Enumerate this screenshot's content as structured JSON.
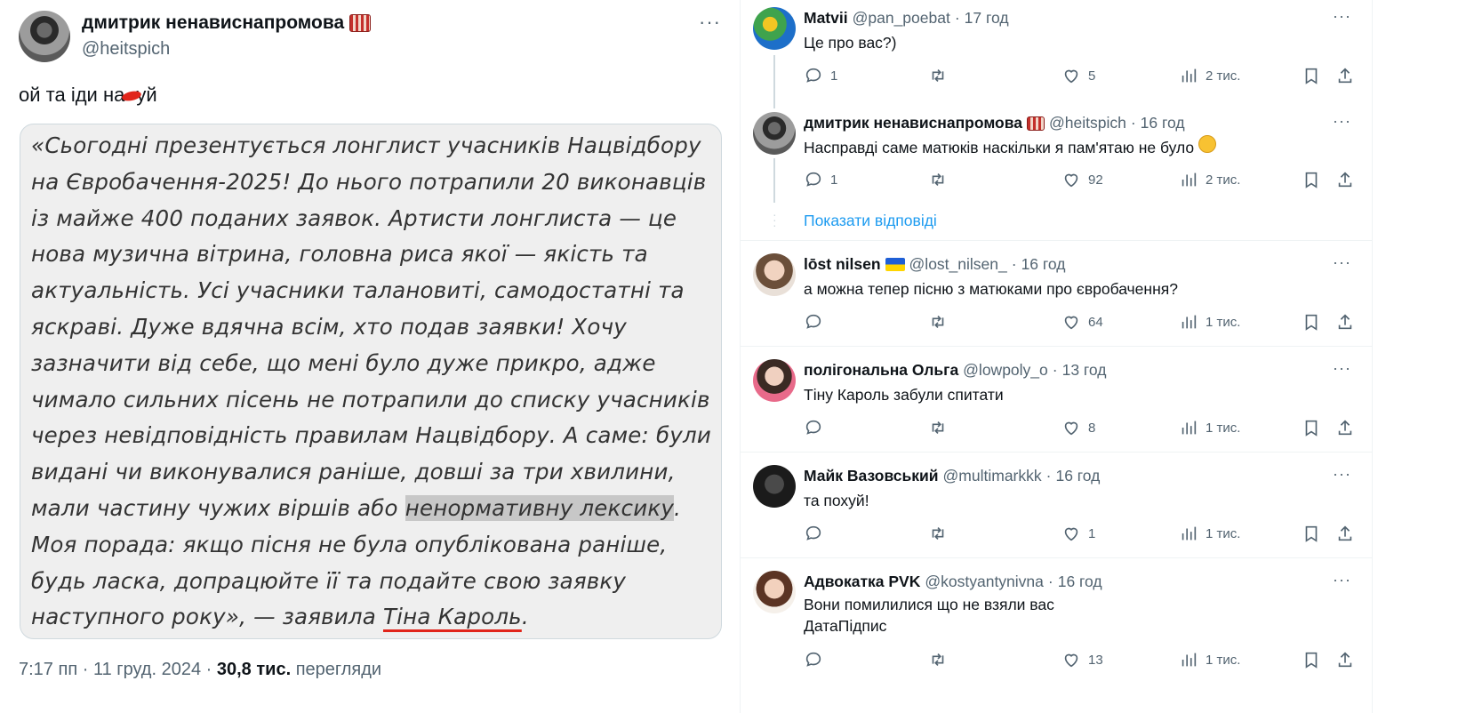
{
  "main_tweet": {
    "author_name": "дмитрик ненависнапромова",
    "author_emoji": "accordion-emoji",
    "handle": "@heitspich",
    "more": "···",
    "text_before": "ой та іди на",
    "text_after": "уй",
    "quote": {
      "part1": "«Сьогодні презентується лонглист учасників Нацвідбору на Євробачення-2025! До нього потрапили 20 виконавців із майже 400 поданих заявок. Артисти лонглиста — це нова музична вітрина, головна риса якої — якість та актуальність. Усі учасники талановиті, самодостатні та яскраві. Дуже вдячна всім, хто подав заявки! Хочу зазначити від себе, що мені було дуже прикро, адже чимало сильних пісень не потрапили до списку учасників через невідповідність правилам Нацвідбору. А саме: були видані чи виконувалися раніше, довші за три хвилини, мали частину чужих віршів або ",
      "highlight": "ненормативну лексику",
      "part2": ". Моя порада: якщо пісня не була опублікована раніше, будь ласка, допрацюйте її та подайте свою заявку наступного року», — заявила ",
      "underlined": "Тіна Кароль",
      "part3": "."
    },
    "time": "7:17 пп",
    "date": "11 груд. 2024",
    "views_count": "30,8 тис.",
    "views_label": "перегляди"
  },
  "replies": [
    {
      "name": "Matvii",
      "handle": "@pan_poebat",
      "time": "17 год",
      "text": "Це про вас?)",
      "replies": "1",
      "retweets": "",
      "likes": "5",
      "views": "2 тис."
    },
    {
      "name": "дмитрик ненависнапромова",
      "handle": "@heitspich",
      "time": "16 год",
      "text": "Насправді саме матюків наскільки я пам'ятаю не було",
      "replies": "1",
      "retweets": "",
      "likes": "92",
      "views": "2 тис."
    },
    {
      "name": "lōst nilsen",
      "handle": "@lost_nilsen_",
      "time": "16 год",
      "text": "а можна тепер пісню з матюками про євробачення?",
      "replies": "",
      "retweets": "",
      "likes": "64",
      "views": "1 тис."
    },
    {
      "name": "полігональна Ольга",
      "handle": "@lowpoly_o",
      "time": "13 год",
      "text": "Тіну Кароль забули спитати",
      "replies": "",
      "retweets": "",
      "likes": "8",
      "views": "1 тис."
    },
    {
      "name": "Майк Вазовський",
      "handle": "@multimarkkk",
      "time": "16 год",
      "text": "та похуй!",
      "replies": "",
      "retweets": "",
      "likes": "1",
      "views": "1 тис."
    },
    {
      "name": "Адвокатка PVK",
      "handle": "@kostyantynivna",
      "time": "16 год",
      "text": "Вони помилилися що не взяли вас",
      "text2": "ДатаПідпис",
      "replies": "",
      "retweets": "",
      "likes": "13",
      "views": "1 тис."
    }
  ],
  "show_replies": "Показати відповіді",
  "separator": "·",
  "icons": [
    "reply-icon",
    "retweet-icon",
    "like-icon",
    "views-icon",
    "bookmark-icon",
    "share-icon",
    "more-icon"
  ],
  "colors": {
    "link": "#1d9bf0",
    "muted": "#536471",
    "redact": "#e1251b"
  }
}
